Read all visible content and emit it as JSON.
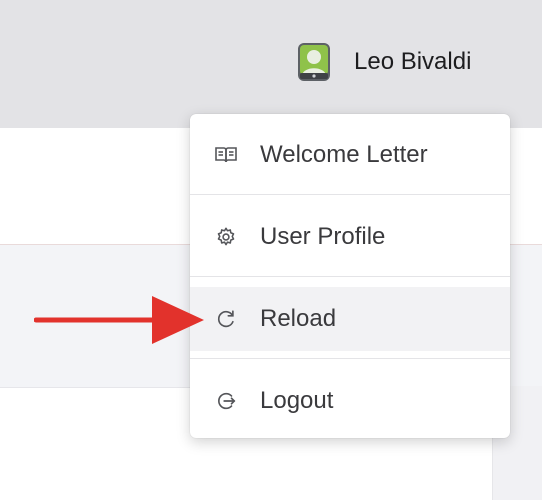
{
  "header": {
    "user_name": "Leo Bivaldi",
    "avatar_icon": "user-avatar-icon"
  },
  "menu": {
    "items": [
      {
        "label": "Welcome Letter",
        "icon": "book-icon"
      },
      {
        "label": "User Profile",
        "icon": "gear-icon"
      },
      {
        "label": "Reload",
        "icon": "reload-icon",
        "active": true
      },
      {
        "label": "Logout",
        "icon": "logout-icon"
      }
    ]
  },
  "annotation": {
    "arrow_color": "#e2322c"
  },
  "colors": {
    "topbar": "#e3e3e6",
    "menu_bg": "#ffffff",
    "active_item_bg": "#f2f2f4",
    "text": "#3a3a3d"
  }
}
